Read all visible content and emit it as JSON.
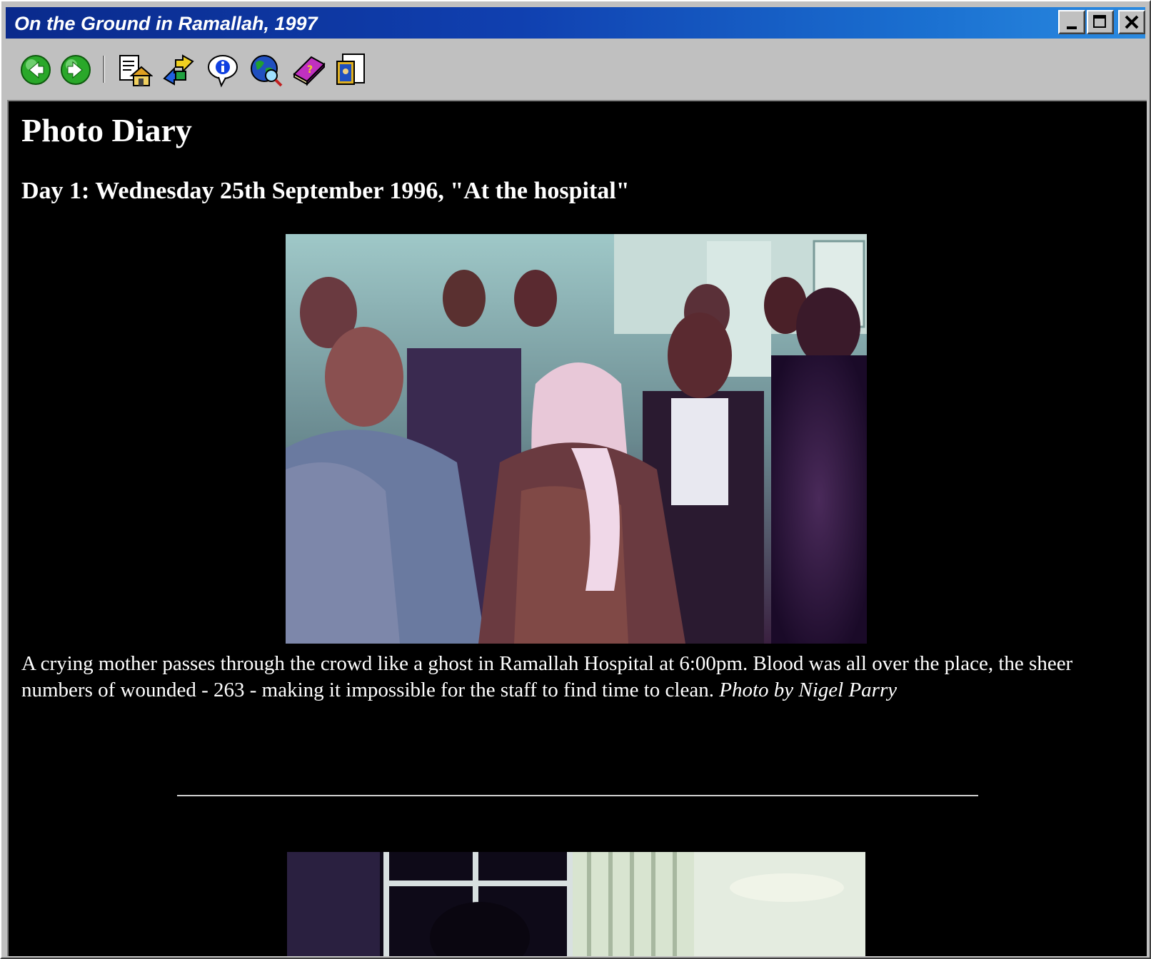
{
  "window": {
    "title": "On the Ground in Ramallah, 1997",
    "controls": {
      "minimize": "minimize",
      "maximize": "maximize",
      "close": "close"
    }
  },
  "toolbar": {
    "buttons": [
      {
        "name": "back",
        "icon": "back-arrow-icon"
      },
      {
        "name": "forward",
        "icon": "forward-arrow-icon"
      },
      {
        "name": "home",
        "icon": "home-page-icon"
      },
      {
        "name": "links",
        "icon": "linked-arrows-icon"
      },
      {
        "name": "info",
        "icon": "info-bubble-icon"
      },
      {
        "name": "web",
        "icon": "globe-search-icon"
      },
      {
        "name": "help",
        "icon": "help-book-icon"
      },
      {
        "name": "about",
        "icon": "framed-picture-icon"
      }
    ]
  },
  "page": {
    "title": "Photo Diary",
    "day_heading": "Day 1: Wednesday 25th September 1996, \"At the hospital\"",
    "caption_text": "A crying mother passes through the crowd like a ghost in Ramallah Hospital at 6:00pm. Blood was all over the place, the sheer numbers of wounded - 263 - making it impossible for the staff to find time to clean. ",
    "caption_credit": "Photo by Nigel Parry"
  },
  "colors": {
    "title_bar_start": "#0a2a8c",
    "title_bar_end": "#2a8ae0",
    "content_background": "#000000",
    "content_text": "#ffffff",
    "chrome": "#c0c0c0"
  }
}
